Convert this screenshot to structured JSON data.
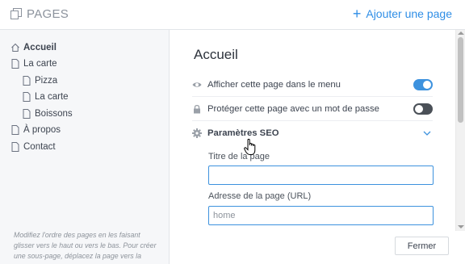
{
  "header": {
    "title": "PAGES",
    "add_page_label": "Ajouter une page"
  },
  "sidebar": {
    "items": [
      {
        "label": "Accueil",
        "icon": "home-icon",
        "active": true
      },
      {
        "label": "La carte",
        "icon": "page-icon"
      },
      {
        "label": "Pizza",
        "icon": "page-icon"
      },
      {
        "label": "La carte",
        "icon": "page-icon"
      },
      {
        "label": "Boissons",
        "icon": "page-icon"
      },
      {
        "label": "À propos",
        "icon": "page-icon"
      },
      {
        "label": "Contact",
        "icon": "page-icon"
      }
    ],
    "note": "Modifiez l'ordre des pages en les faisant glisser vers le haut ou vers le bas. Pour créer une sous-page, déplacez la page vers la"
  },
  "main": {
    "title": "Accueil",
    "show_in_menu": {
      "label": "Afficher cette page dans le menu",
      "on": true
    },
    "password_protect": {
      "label": "Protéger cette page avec un mot de passe",
      "on": false
    },
    "seo": {
      "label": "Paramètres SEO",
      "page_title_label": "Titre de la page",
      "page_title_value": "",
      "url_label": "Adresse de la page (URL)",
      "url_placeholder": "home"
    },
    "close_label": "Fermer"
  },
  "colors": {
    "accent": "#3d92de",
    "link": "#2f8ee6",
    "toggle_off": "#4a5057",
    "sidebar_bg": "#f6f7f9"
  }
}
